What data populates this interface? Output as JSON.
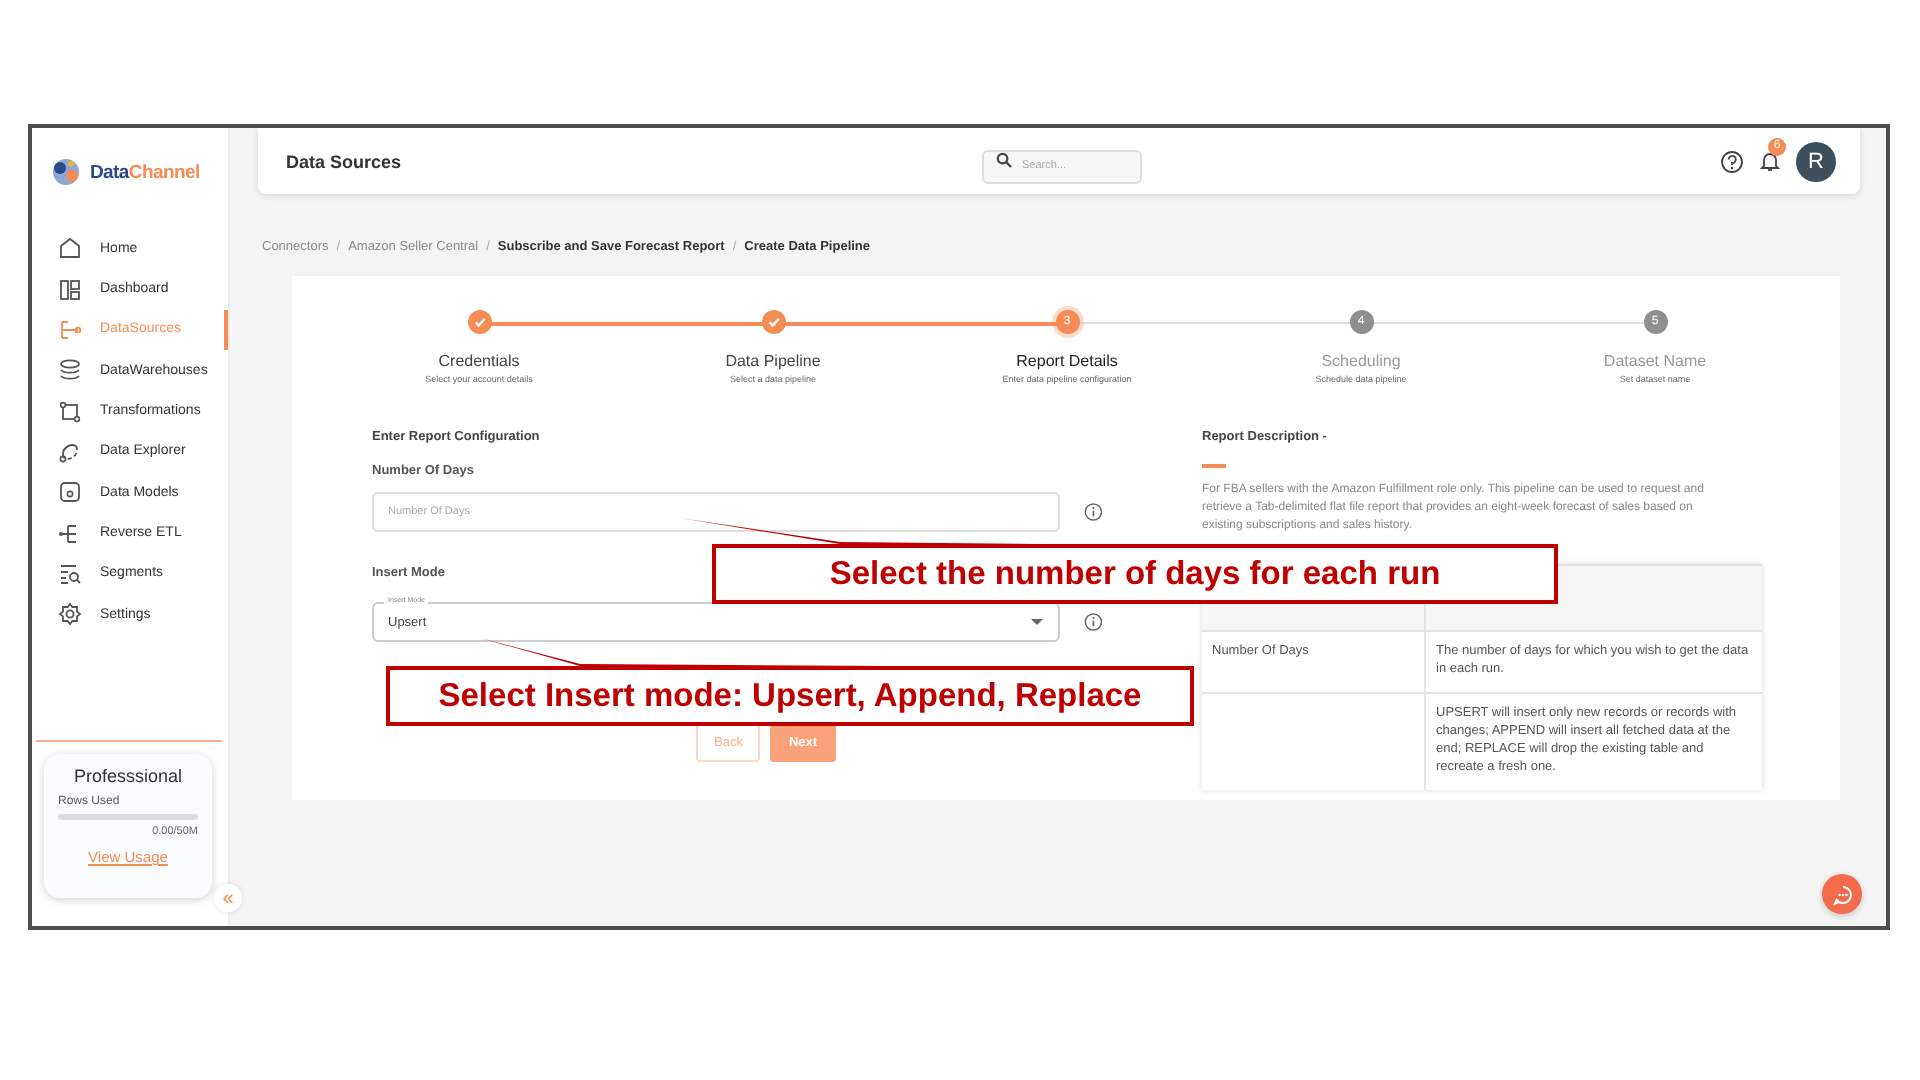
{
  "sidebar": {
    "logo": [
      "Data",
      "Channel"
    ],
    "items": [
      {
        "label": "Home",
        "selected": false
      },
      {
        "label": "Dashboard",
        "selected": false
      },
      {
        "label": "DataSources",
        "selected": true
      },
      {
        "label": "DataWarehouses",
        "selected": false
      },
      {
        "label": "Transformations",
        "selected": false
      },
      {
        "label": "Data Explorer",
        "selected": false
      },
      {
        "label": "Data Models",
        "selected": false
      },
      {
        "label": "Reverse ETL",
        "selected": false
      },
      {
        "label": "Segments",
        "selected": false
      },
      {
        "label": "Settings",
        "selected": false
      }
    ],
    "plan": {
      "title": "Professsional",
      "usage_label": "Rows Used",
      "level": 0,
      "usage": "0.00/50M",
      "link": "View Usage"
    },
    "collapse": "«"
  },
  "header": {
    "title": "Data Sources",
    "search": {
      "placeholder": "Search..."
    },
    "notifications": "6",
    "avatar": "R"
  },
  "breadcrumb": [
    {
      "label": "Connectors",
      "current": false
    },
    {
      "separator": "/",
      "label": "Amazon Seller Central",
      "current": false
    },
    {
      "separator": "/",
      "label": "Subscribe and Save Forecast Report",
      "current": true
    },
    {
      "separator": "/",
      "label": "Create Data Pipeline",
      "current": true
    }
  ],
  "steps": [
    {
      "label": "Credentials",
      "caption": "Select your account details",
      "done": true,
      "selected": false
    },
    {
      "label": "Data Pipeline",
      "caption": "Select a data pipeline",
      "done": true,
      "selected": false
    },
    {
      "label": "Report Details",
      "caption": "Enter data pipeline configuration",
      "done": false,
      "selected": true,
      "number": "3"
    },
    {
      "label": "Scheduling",
      "caption": "Schedule data pipeline",
      "done": false,
      "selected": false,
      "number": "4"
    },
    {
      "label": "Dataset Name",
      "caption": "Set dataset name",
      "done": false,
      "selected": false,
      "number": "5"
    }
  ],
  "form": {
    "heading": "Enter Report Configuration",
    "fields": [
      {
        "kind": "text",
        "label": "Number Of Days",
        "placeholder": "Number Of Days"
      },
      {
        "kind": "select",
        "label": "Insert Mode",
        "floating_label": "Insert Mode",
        "value": "Upsert"
      }
    ],
    "buttons": [
      {
        "label": "Back",
        "kind": "secondary"
      },
      {
        "label": "Next",
        "kind": "primary"
      }
    ]
  },
  "description": {
    "title": "Report Description -",
    "text": "For FBA sellers with the Amazon Fulfillment role only. This pipeline can be used to request and retrieve a Tab-delimited flat file report that provides an eight-week forecast of sales based on existing subscriptions and sales history.",
    "rows": [
      {
        "parameter": "Number Of Days",
        "description": "The number of days for which you wish to get the data in each run."
      },
      {
        "description": "UPSERT will insert only new records or records with changes; APPEND will insert all fetched data at the end; REPLACE will drop the existing table and recreate a fresh one."
      }
    ]
  },
  "callouts": [
    {
      "text": "Select the number of days for each run"
    },
    {
      "text": "Select Insert mode: Upsert, Append, Replace"
    }
  ]
}
